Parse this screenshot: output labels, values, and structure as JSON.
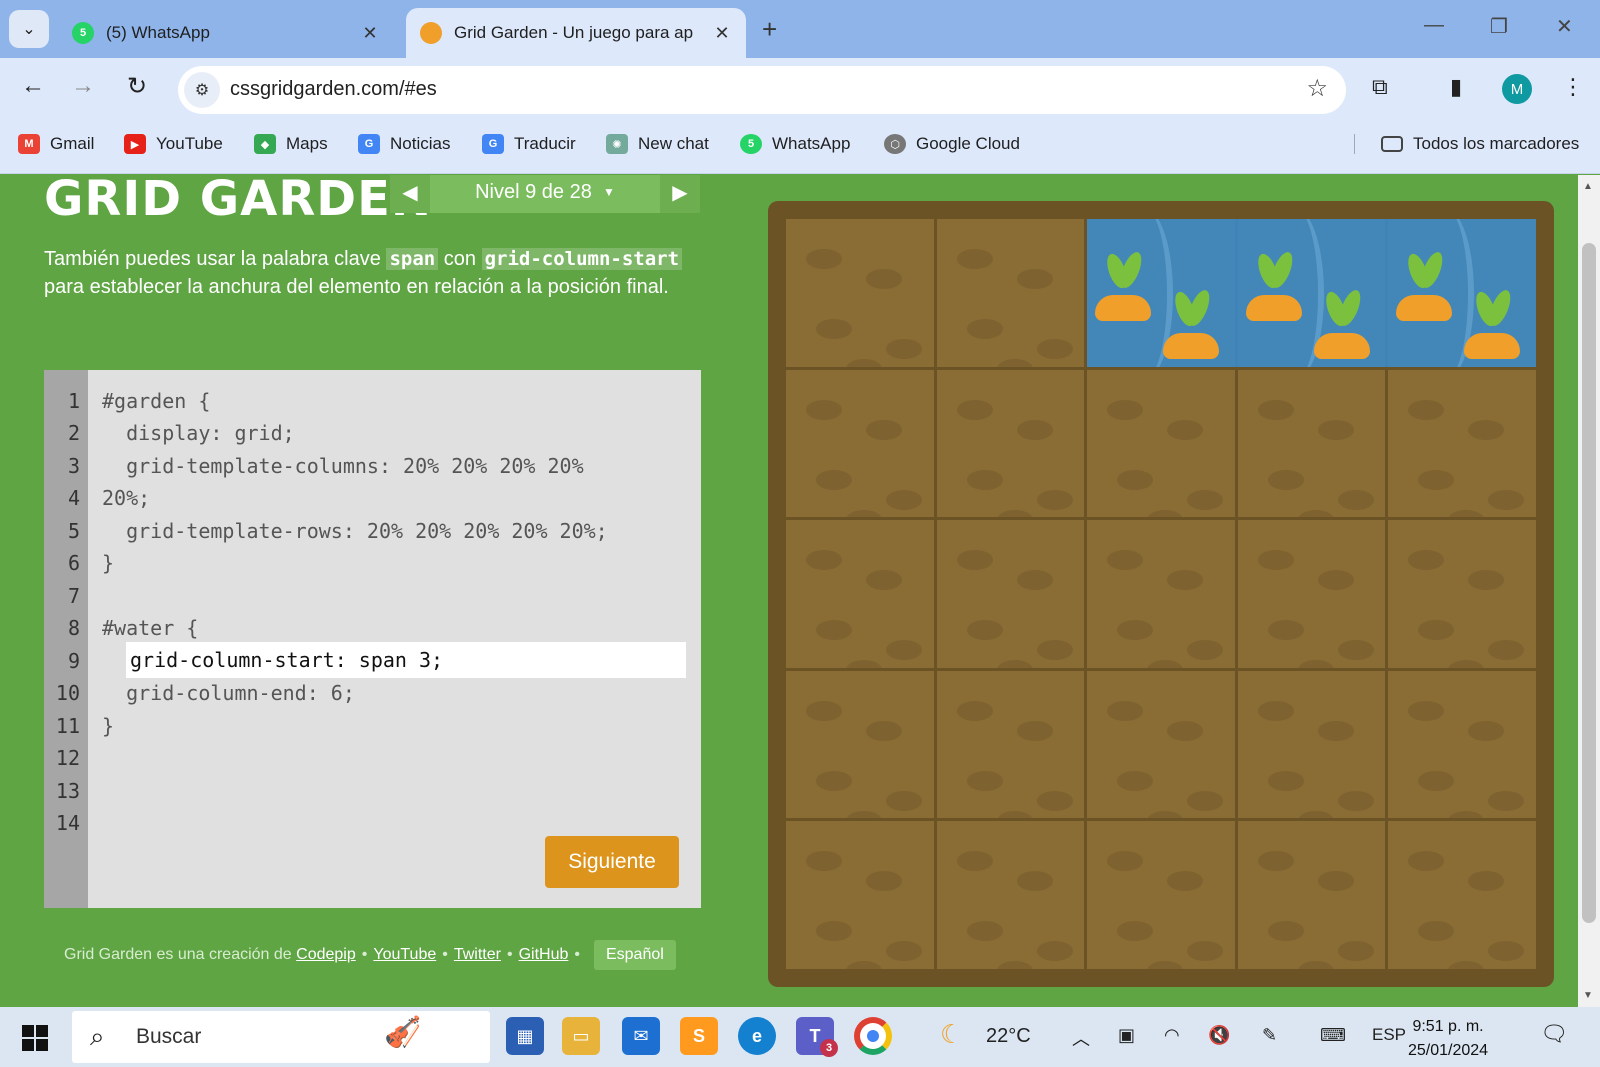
{
  "browser": {
    "tabs": [
      {
        "title": "(5) WhatsApp",
        "badge": "5",
        "active": false
      },
      {
        "title": "Grid Garden - Un juego para ap",
        "active": true
      }
    ],
    "url": "cssgridgarden.com/#es",
    "profile_initial": "M",
    "bookmarks": [
      "Gmail",
      "YouTube",
      "Maps",
      "Noticias",
      "Traducir",
      "New chat",
      "WhatsApp",
      "Google Cloud"
    ],
    "all_bookmarks": "Todos los marcadores",
    "whatsapp_badge": "5"
  },
  "game": {
    "logo": "GRID GARDEN",
    "level": "Nivel 9 de 28",
    "instructions": {
      "part1": "También puedes usar la palabra clave ",
      "kw1": "span",
      "part2": " con ",
      "kw2": "grid-column-start",
      "part3": " para establecer la anchura del elemento en relación a la posición final."
    },
    "editor": {
      "line_numbers": [
        "1",
        "2",
        "3",
        "4",
        "5",
        "6",
        "7",
        "8",
        "9",
        "10",
        "11",
        "12",
        "13",
        "14"
      ],
      "code_lines": [
        "#garden {",
        "  display: grid;",
        "  grid-template-columns: 20% 20% 20% 20%",
        "20%;",
        "  grid-template-rows: 20% 20% 20% 20% 20%;",
        "}",
        "",
        "#water {",
        "",
        "  grid-column-end: 6;",
        "}"
      ],
      "input_value": "grid-column-start: span 3;",
      "next_button": "Siguiente"
    },
    "footer": {
      "text": "Grid Garden es una creación de",
      "links": [
        "Codepip",
        "YouTube",
        "Twitter",
        "GitHub"
      ],
      "language": "Español"
    },
    "garden": {
      "rows": 5,
      "columns": 5,
      "water_column_start": 3,
      "water_column_end": 6,
      "water_row": 1,
      "carrots_per_water_cell": 2
    }
  },
  "taskbar": {
    "search_placeholder": "Buscar",
    "teams_badge": "3",
    "weather": "22°C",
    "language": "ESP",
    "time": "9:51 p. m.",
    "date": "25/01/2024"
  }
}
